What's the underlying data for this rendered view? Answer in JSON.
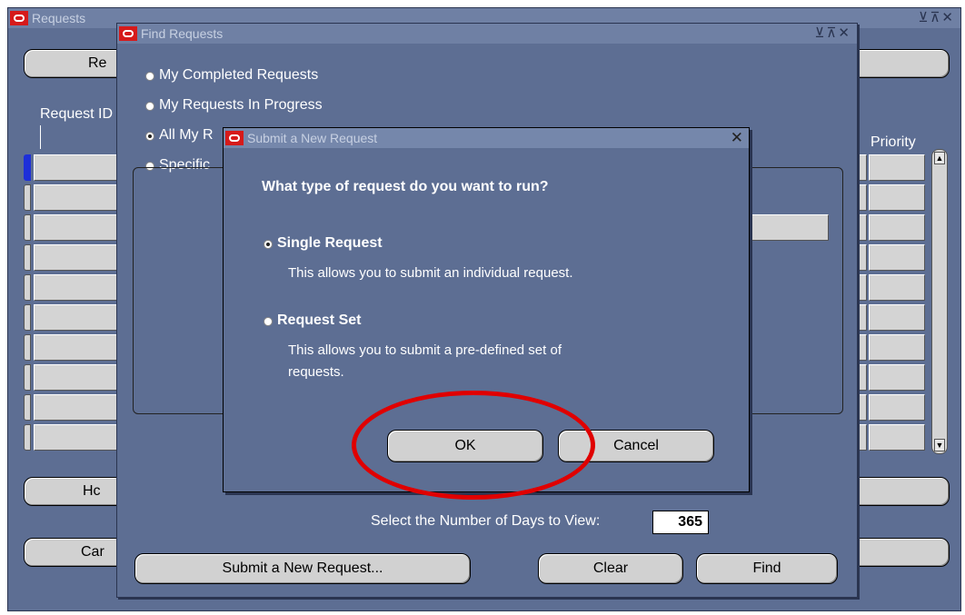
{
  "requests_window": {
    "title": "Requests",
    "controls": "⊻⊼✕",
    "column_request_id": "Request ID",
    "column_priority": "Priority",
    "btn_top_left": "Re",
    "btn_mid_left": "Hc",
    "btn_bottom_left": "Car"
  },
  "find_window": {
    "title": "Find Requests",
    "controls": "⊻⊼✕",
    "options": [
      {
        "label": "My Completed Requests",
        "selected": false
      },
      {
        "label": "My Requests In Progress",
        "selected": false
      },
      {
        "label": "All My R",
        "selected": true
      },
      {
        "label": "Specific",
        "selected": false
      }
    ],
    "days_label": "Select the Number of Days to View:",
    "days_value": "365",
    "submit_button": "Submit a New Request...",
    "clear_button": "Clear",
    "find_button": "Find"
  },
  "dialog": {
    "title": "Submit a New Request",
    "close": "✕",
    "question": "What type of request do you want to run?",
    "single_label": "Single Request",
    "single_desc": "This allows you to submit an individual request.",
    "set_label": "Request Set",
    "set_desc_line1": "This allows you to submit a pre-defined set of",
    "set_desc_line2": "requests.",
    "selected": "single",
    "ok_button": "OK",
    "cancel_button": "Cancel"
  },
  "colors": {
    "window_bg": "#5d6e93",
    "button_bg": "#d1d1d1",
    "highlight": "#e00000",
    "active_row": "#1d2fd9"
  }
}
